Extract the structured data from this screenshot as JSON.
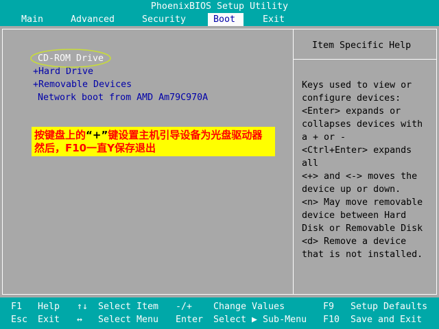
{
  "window": {
    "title": "PhoenixBIOS Setup Utility"
  },
  "menu": {
    "items": [
      {
        "label": "Main"
      },
      {
        "label": "Advanced"
      },
      {
        "label": "Security"
      },
      {
        "label": "Boot"
      },
      {
        "label": "Exit"
      }
    ],
    "selected": "Boot"
  },
  "boot_order": {
    "items": [
      {
        "label": "CD-ROM Drive",
        "selected": true
      },
      {
        "label": "+Hard Drive"
      },
      {
        "label": "+Removable Devices"
      },
      {
        "label": "Network boot from AMD Am79C970A"
      }
    ]
  },
  "annotation": {
    "line1": {
      "before": "按键盘上的",
      "key": "“+”",
      "after": "键设置主机引导设备为光盘驱动器"
    },
    "line2": "然后，F10一直Y保存退出"
  },
  "help": {
    "title": "Item Specific Help",
    "lines": [
      "Keys used to view or",
      "configure devices:",
      "<Enter> expands or",
      "collapses devices with",
      "a + or -",
      "<Ctrl+Enter> expands",
      "all",
      "<+> and <-> moves the",
      "device up or down.",
      "<n> May move removable",
      "device between Hard",
      "Disk or Removable Disk",
      "<d> Remove a device",
      "that is not installed."
    ]
  },
  "legend": {
    "rows": [
      [
        {
          "key": "F1",
          "desc": "Help"
        },
        {
          "key": "↑↓",
          "desc": "Select Item"
        },
        {
          "key": "-/+",
          "desc": "Change Values"
        },
        {
          "key": "F9",
          "desc": "Setup Defaults"
        }
      ],
      [
        {
          "key": "Esc",
          "desc": "Exit"
        },
        {
          "key": "↔",
          "desc": "Select Menu"
        },
        {
          "key": "Enter",
          "desc": "Select ▶ Sub-Menu"
        },
        {
          "key": "F10",
          "desc": "Save and Exit"
        }
      ]
    ]
  },
  "icons": {
    "up_down": "up-down-arrows-icon",
    "left_right": "left-right-arrow-icon",
    "submenu": "right-triangle-icon"
  },
  "colors": {
    "bios_cyan": "#00a8a8",
    "bios_blue": "#0000a8",
    "panel_gray": "#a8a8a8",
    "bright_white": "#fcfcfc",
    "annotation_yellow": "#ffff00",
    "annotation_red": "#ff0000",
    "highlight_oval": "#c8dc3a"
  }
}
